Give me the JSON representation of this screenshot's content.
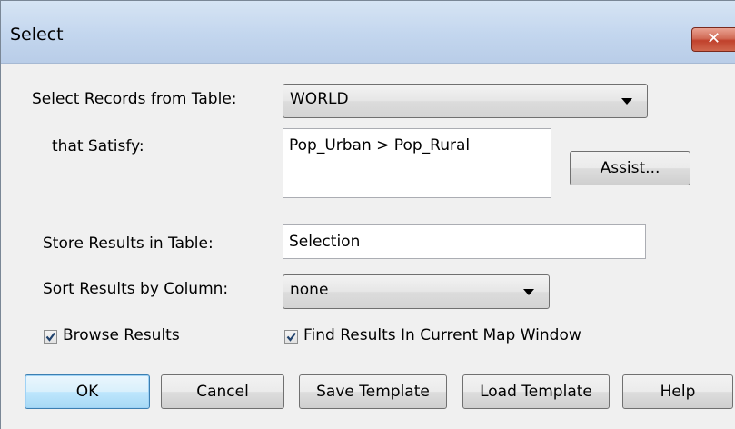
{
  "window": {
    "title": "Select",
    "close_glyph": "✕"
  },
  "form": {
    "table_label": "Select Records from Table:",
    "table_value": "WORLD",
    "satisfy_label": "that Satisfy:",
    "expression": "Pop_Urban > Pop_Rural",
    "store_label": "Store Results in Table:",
    "store_value": "Selection",
    "sort_label": "Sort Results by Column:",
    "sort_value": "none",
    "browse_label": "Browse Results",
    "browse_checked": true,
    "find_label": "Find Results In Current Map Window",
    "find_checked": true
  },
  "buttons": {
    "assist": "Assist...",
    "ok": "OK",
    "cancel": "Cancel",
    "save_template": "Save Template",
    "load_template": "Load Template",
    "help": "Help"
  },
  "icons": {
    "close": "close-icon",
    "dropdown": "chevron-down-icon",
    "check": "checkmark-icon"
  }
}
